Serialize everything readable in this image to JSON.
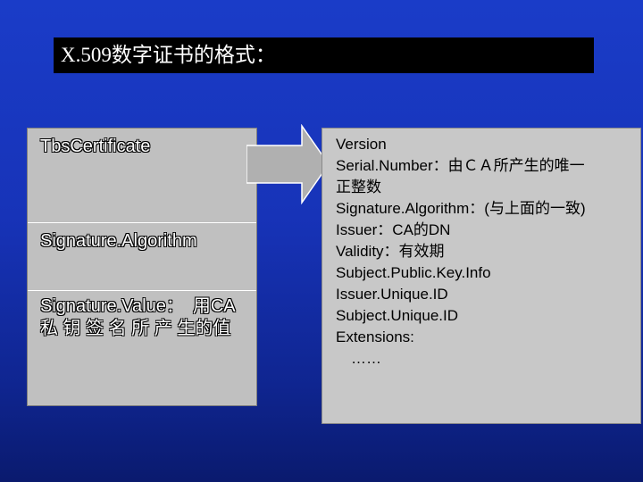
{
  "title": "X.509数字证书的格式：",
  "left_panel": {
    "cells": [
      "TbsCertificate",
      "Signature.Algorithm",
      "Signature.Value：　用CA私 钥 签 名 所 产 生的值"
    ]
  },
  "right_panel": {
    "fields": [
      "Version",
      "Serial.Number：由ＣＡ所产生的唯一",
      "正整数",
      "Signature.Algorithm：(与上面的一致)",
      "Issuer：CA的DN",
      "Validity：有效期",
      "Subject.Public.Key.Info",
      "Issuer.Unique.ID",
      "Subject.Unique.ID",
      "Extensions:",
      "　……"
    ]
  },
  "colors": {
    "background": "#1a3cc8",
    "title_bar": "#000000",
    "panel": "#c0c0c0",
    "arrow": "#b0b0b0"
  }
}
